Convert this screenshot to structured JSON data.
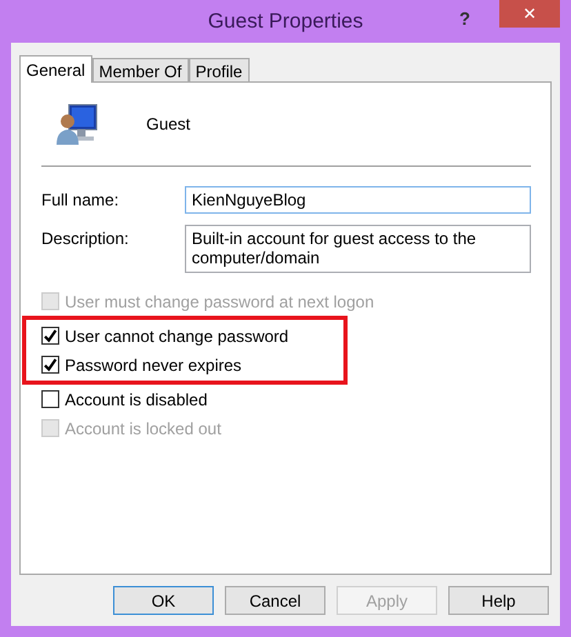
{
  "window": {
    "title": "Guest Properties",
    "help_glyph": "?",
    "close_glyph": "✕"
  },
  "tabs": [
    {
      "label": "General",
      "selected": true
    },
    {
      "label": "Member Of",
      "selected": false
    },
    {
      "label": "Profile",
      "selected": false
    }
  ],
  "user": {
    "name": "Guest"
  },
  "fields": [
    {
      "label": "Full name:",
      "value": "KienNguyeBlog",
      "focused": true,
      "multiline": false
    },
    {
      "label": "Description:",
      "value": "Built-in account for guest access to the computer/domain",
      "focused": false,
      "multiline": true
    }
  ],
  "checkboxes": [
    {
      "label": "User must change password at next logon",
      "checked": false,
      "disabled": true,
      "highlighted": false
    },
    {
      "label": "User cannot change password",
      "checked": true,
      "disabled": false,
      "highlighted": true
    },
    {
      "label": "Password never expires",
      "checked": true,
      "disabled": false,
      "highlighted": true
    },
    {
      "label": "Account is disabled",
      "checked": false,
      "disabled": false,
      "highlighted": false
    },
    {
      "label": "Account is locked out",
      "checked": false,
      "disabled": true,
      "highlighted": false
    }
  ],
  "buttons": [
    {
      "label": "OK",
      "default": true,
      "disabled": false
    },
    {
      "label": "Cancel",
      "default": false,
      "disabled": false
    },
    {
      "label": "Apply",
      "default": false,
      "disabled": true
    },
    {
      "label": "Help",
      "default": false,
      "disabled": false
    }
  ]
}
